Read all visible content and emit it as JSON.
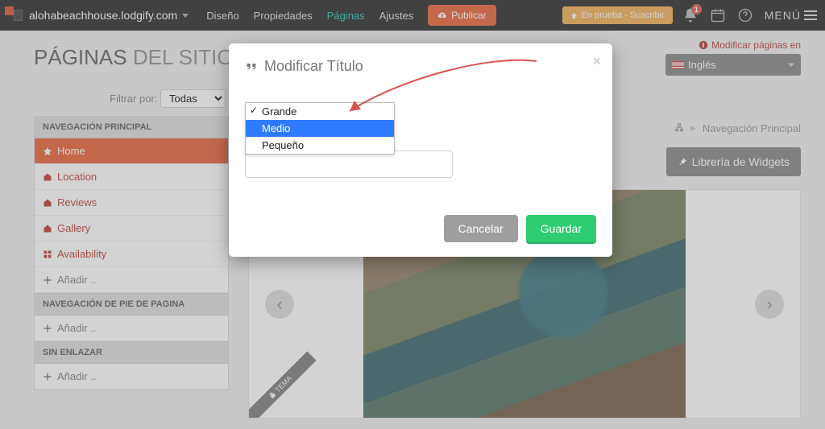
{
  "header": {
    "site_url": "alohabeachhouse.lodgify.com",
    "nav": {
      "design": "Diseño",
      "properties": "Propiedades",
      "pages": "Páginas",
      "settings": "Ajustes"
    },
    "publish_label": "Publicar",
    "trial_label": "En prueba - Suscribir",
    "notifications_count": "1",
    "menu_label": "MENÚ"
  },
  "page": {
    "heading_strong": "PÁGINAS",
    "heading_light": "DEL SITIO WEB",
    "filter_label": "Filtrar por:",
    "filter_value": "Todas"
  },
  "sidebar": {
    "section_main": "NAVEGACIÓN PRINCIPAL",
    "items": [
      {
        "label": "Home"
      },
      {
        "label": "Location"
      },
      {
        "label": "Reviews"
      },
      {
        "label": "Gallery"
      },
      {
        "label": "Availability"
      }
    ],
    "add_label": "Añadir ..",
    "section_footer": "NAVEGACIÓN DE PIE DE PAGINA",
    "section_unlinked": "SIN ENLAZAR"
  },
  "rightcol": {
    "modify_msg": "Modificar páginas en",
    "language_value": "Inglés",
    "breadcrumb": "Navegación Principal",
    "widgets_label": "Librería de Widgets",
    "tema_label": "TEMA"
  },
  "modal": {
    "title": "Modificar Título",
    "options": {
      "large": "Grande",
      "medium": "Medio",
      "small": "Pequeño"
    },
    "input_value": "",
    "cancel_label": "Cancelar",
    "save_label": "Guardar"
  }
}
